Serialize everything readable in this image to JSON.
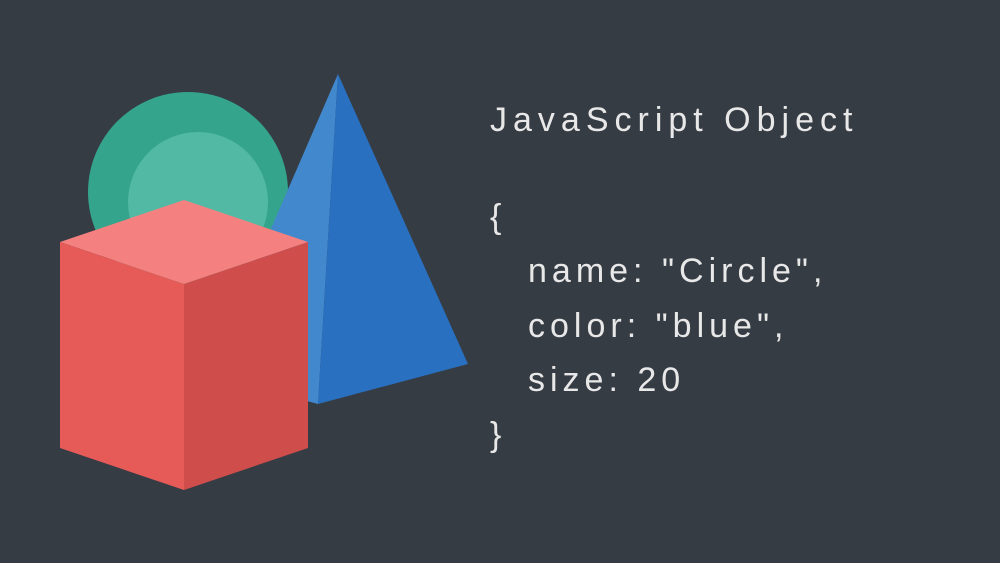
{
  "title": "JavaScript Object",
  "code": {
    "open": "{",
    "line1": "name: \"Circle\",",
    "line2": "color: \"blue\",",
    "line3": "size: 20",
    "close": "}"
  },
  "shapes": {
    "circle_outer_color": "#35a48d",
    "circle_inner_color": "#52b9a4",
    "triangle_left_color": "#4288cc",
    "triangle_right_color": "#2970c0",
    "cube_top_color": "#f4817f",
    "cube_left_color": "#e65a58",
    "cube_right_color": "#cf4e4c"
  }
}
